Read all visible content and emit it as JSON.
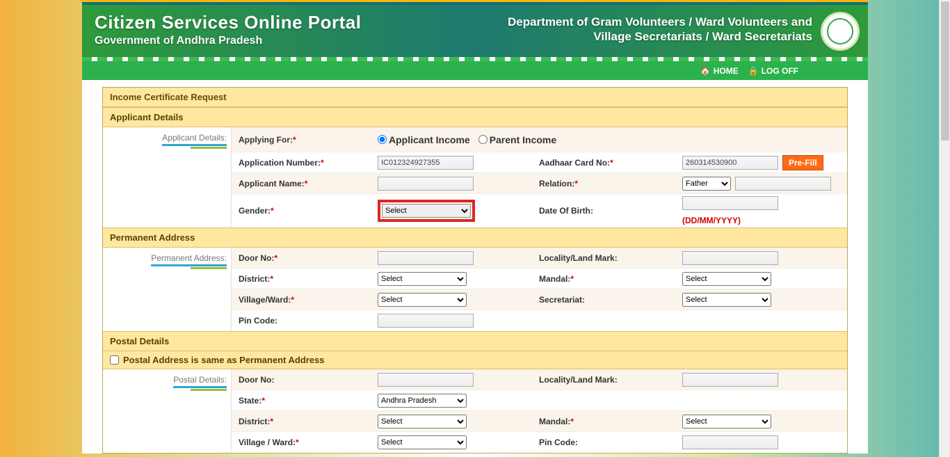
{
  "header": {
    "title": "Citizen Services Online Portal",
    "subtitle": "Government of Andhra Pradesh",
    "dept_line1": "Department of Gram Volunteers / Ward Volunteers and",
    "dept_line2": "Village Secretariats / Ward Secretariats"
  },
  "nav": {
    "home": "HOME",
    "logoff": "LOG OFF"
  },
  "form": {
    "main_title": "Income Certificate Request",
    "applicant_section": "Applicant Details",
    "applicant_side": "Applicant Details:",
    "applying_for_label": "Applying For:",
    "applying_option1": "Applicant Income",
    "applying_option2": "Parent Income",
    "app_no_label": "Application Number:",
    "app_no_value": "IC012324927355",
    "aadhaar_label": "Aadhaar Card No:",
    "aadhaar_value": "260314530900",
    "prefill_label": "Pre-Fill",
    "applicant_name_label": "Applicant Name:",
    "relation_label": "Relation:",
    "relation_value": "Father",
    "gender_label": "Gender:",
    "gender_value": "Select",
    "dob_label": "Date Of Birth:",
    "dob_hint": "(DD/MM/YYYY)"
  },
  "perm": {
    "section": "Permanent Address",
    "side": "Permanent Address:",
    "door_label": "Door No:",
    "locality_label": "Locality/Land Mark:",
    "district_label": "District:",
    "district_value": "Select",
    "mandal_label": "Mandal:",
    "mandal_value": "Select",
    "village_label": "Village/Ward:",
    "village_value": "Select",
    "secretariat_label": "Secretariat:",
    "secretariat_value": "Select",
    "pincode_label": "Pin Code:"
  },
  "postal": {
    "section": "Postal Details",
    "same_label": "Postal Address is same as Permanent Address",
    "side": "Postal Details:",
    "door_label": "Door No:",
    "locality_label": "Locality/Land Mark:",
    "state_label": "State:",
    "state_value": "Andhra Pradesh",
    "district_label": "District:",
    "district_value": "Select",
    "mandal_label": "Mandal:",
    "mandal_value": "Select",
    "village_label": "Village / Ward:",
    "village_value": "Select",
    "pincode_label": "Pin Code:"
  }
}
